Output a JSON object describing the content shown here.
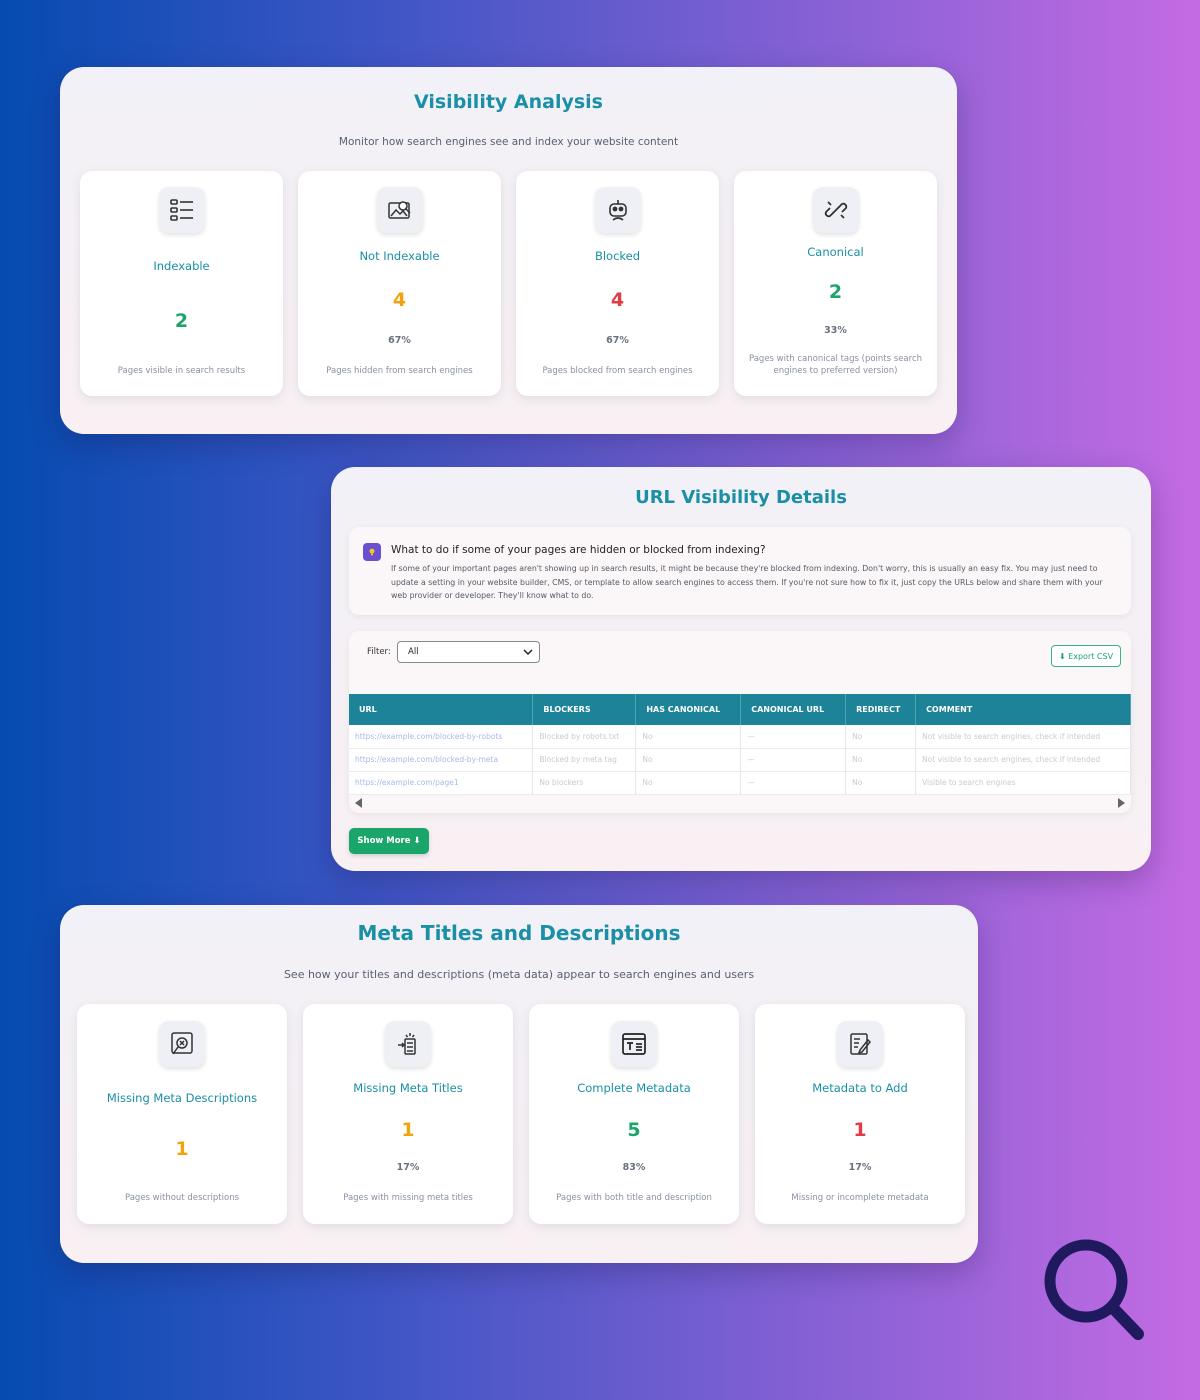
{
  "visibility": {
    "title": "Visibility Analysis",
    "subtitle": "Monitor how search engines see and index your website content",
    "cards": [
      {
        "icon": "list-icon",
        "label": "Indexable",
        "value": "2",
        "percent": "",
        "desc": "Pages visible in search results"
      },
      {
        "icon": "search-image-icon",
        "label": "Not Indexable",
        "value": "4",
        "percent": "67%",
        "desc": "Pages hidden from search engines"
      },
      {
        "icon": "robot-icon",
        "label": "Blocked",
        "value": "4",
        "percent": "67%",
        "desc": "Pages blocked from search engines"
      },
      {
        "icon": "broken-link-icon",
        "label": "Canonical",
        "value": "2",
        "percent": "33%",
        "desc": "Pages with canonical tags (points search engines to preferred version)"
      }
    ]
  },
  "url_details": {
    "title": "URL Visibility Details",
    "tip_title": "What to do if some of your pages are hidden or blocked from indexing?",
    "tip_text": "If some of your important pages aren't showing up in search results, it might be because they're blocked from indexing. Don't worry, this is usually an easy fix. You may just need to update a setting in your website builder, CMS, or template to allow search engines to access them. If you're not sure how to fix it, just copy the URLs below and share them with your web provider or developer. They'll know what to do.",
    "filter_label": "Filter:",
    "filter_value": "All",
    "export_label": "⬇ Export CSV",
    "columns": [
      "URL",
      "BLOCKERS",
      "HAS CANONICAL",
      "CANONICAL URL",
      "REDIRECT",
      "COMMENT"
    ],
    "rows": [
      [
        "https://example.com/blocked-by-robots",
        "Blocked by robots.txt",
        "No",
        "—",
        "No",
        "Not visible to search engines, check if intended"
      ],
      [
        "https://example.com/blocked-by-meta",
        "Blocked by meta tag",
        "No",
        "—",
        "No",
        "Not visible to search engines, check if intended"
      ],
      [
        "https://example.com/page1",
        "No blockers",
        "No",
        "—",
        "No",
        "Visible to search engines"
      ]
    ],
    "show_more": "Show More ⬇"
  },
  "meta": {
    "title": "Meta Titles and Descriptions",
    "subtitle": "See how your titles and descriptions (meta data) appear to search engines and users",
    "cards": [
      {
        "icon": "magnifier-doc-icon",
        "label": "Missing Meta Descriptions",
        "value": "1",
        "percent": "",
        "desc": "Pages without descriptions"
      },
      {
        "icon": "meter-icon",
        "label": "Missing Meta Titles",
        "value": "1",
        "percent": "17%",
        "desc": "Pages with missing meta titles"
      },
      {
        "icon": "text-window-icon",
        "label": "Complete Metadata",
        "value": "5",
        "percent": "83%",
        "desc": "Pages with both title and description"
      },
      {
        "icon": "edit-doc-icon",
        "label": "Metadata to Add",
        "value": "1",
        "percent": "17%",
        "desc": "Missing or incomplete metadata"
      }
    ]
  },
  "colors": {
    "accent": "#1a8fa6",
    "green": "#1aa56a",
    "orange": "#f2a20c",
    "red": "#e23c44"
  }
}
